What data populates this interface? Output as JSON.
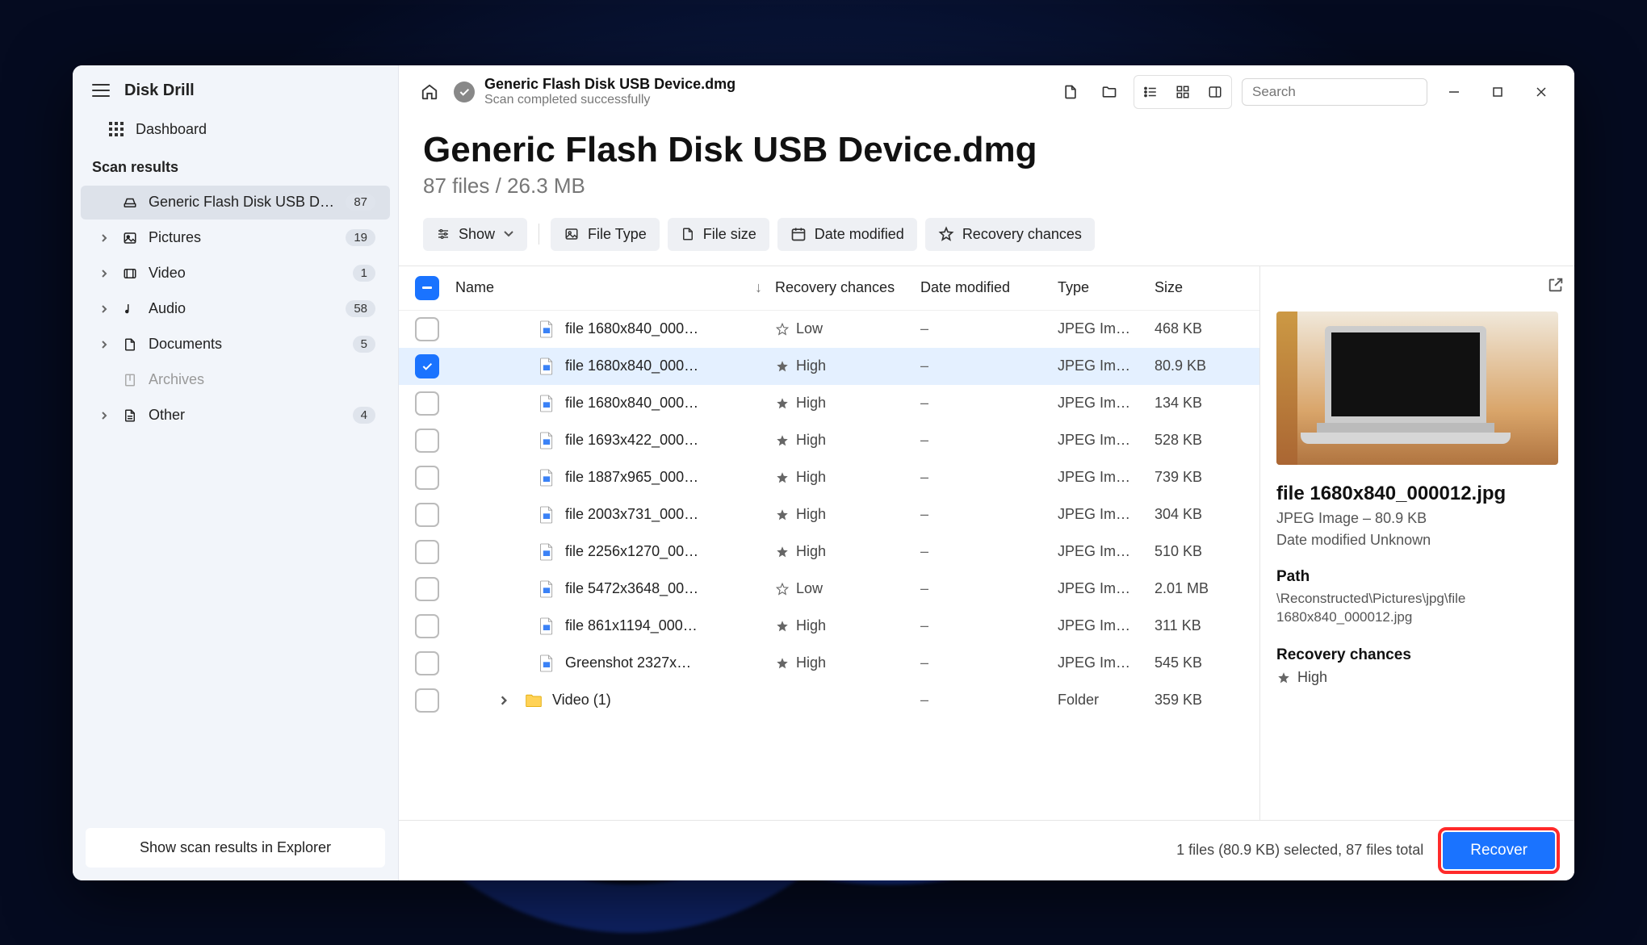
{
  "app_name": "Disk Drill",
  "sidebar": {
    "dashboard": "Dashboard",
    "section": "Scan results",
    "items": [
      {
        "icon": "disk",
        "label": "Generic Flash Disk USB D…",
        "count": "87",
        "active": true,
        "expandable": false
      },
      {
        "icon": "picture",
        "label": "Pictures",
        "count": "19",
        "active": false,
        "expandable": true
      },
      {
        "icon": "video",
        "label": "Video",
        "count": "1",
        "active": false,
        "expandable": true
      },
      {
        "icon": "audio",
        "label": "Audio",
        "count": "58",
        "active": false,
        "expandable": true
      },
      {
        "icon": "document",
        "label": "Documents",
        "count": "5",
        "active": false,
        "expandable": true
      },
      {
        "icon": "archive",
        "label": "Archives",
        "count": "",
        "active": false,
        "expandable": false,
        "muted": true
      },
      {
        "icon": "other",
        "label": "Other",
        "count": "4",
        "active": false,
        "expandable": true
      }
    ],
    "footer_button": "Show scan results in Explorer"
  },
  "header": {
    "title": "Generic Flash Disk USB Device.dmg",
    "subtitle": "Scan completed successfully",
    "search_placeholder": "Search"
  },
  "page": {
    "title": "Generic Flash Disk USB Device.dmg",
    "subtitle": "87 files / 26.3 MB"
  },
  "filters": {
    "show": "Show",
    "file_type": "File Type",
    "file_size": "File size",
    "date_modified": "Date modified",
    "recovery": "Recovery chances"
  },
  "columns": {
    "name": "Name",
    "recovery": "Recovery chances",
    "date": "Date modified",
    "type": "Type",
    "size": "Size"
  },
  "rows": [
    {
      "checked": false,
      "name": "file 1680x840_000…",
      "chance": "Low",
      "star": "hollow",
      "date": "–",
      "type": "JPEG Im…",
      "size": "468 KB",
      "kind": "file"
    },
    {
      "checked": true,
      "name": "file 1680x840_000…",
      "chance": "High",
      "star": "filled",
      "date": "–",
      "type": "JPEG Im…",
      "size": "80.9 KB",
      "kind": "file"
    },
    {
      "checked": false,
      "name": "file 1680x840_000…",
      "chance": "High",
      "star": "filled",
      "date": "–",
      "type": "JPEG Im…",
      "size": "134 KB",
      "kind": "file"
    },
    {
      "checked": false,
      "name": "file 1693x422_000…",
      "chance": "High",
      "star": "filled",
      "date": "–",
      "type": "JPEG Im…",
      "size": "528 KB",
      "kind": "file"
    },
    {
      "checked": false,
      "name": "file 1887x965_000…",
      "chance": "High",
      "star": "filled",
      "date": "–",
      "type": "JPEG Im…",
      "size": "739 KB",
      "kind": "file"
    },
    {
      "checked": false,
      "name": "file 2003x731_000…",
      "chance": "High",
      "star": "filled",
      "date": "–",
      "type": "JPEG Im…",
      "size": "304 KB",
      "kind": "file"
    },
    {
      "checked": false,
      "name": "file 2256x1270_00…",
      "chance": "High",
      "star": "filled",
      "date": "–",
      "type": "JPEG Im…",
      "size": "510 KB",
      "kind": "file"
    },
    {
      "checked": false,
      "name": "file 5472x3648_00…",
      "chance": "Low",
      "star": "hollow",
      "date": "–",
      "type": "JPEG Im…",
      "size": "2.01 MB",
      "kind": "file"
    },
    {
      "checked": false,
      "name": "file 861x1194_000…",
      "chance": "High",
      "star": "filled",
      "date": "–",
      "type": "JPEG Im…",
      "size": "311 KB",
      "kind": "file"
    },
    {
      "checked": false,
      "name": "Greenshot 2327x…",
      "chance": "High",
      "star": "filled",
      "date": "–",
      "type": "JPEG Im…",
      "size": "545 KB",
      "kind": "file"
    },
    {
      "checked": false,
      "name": "Video (1)",
      "chance": "",
      "star": "",
      "date": "–",
      "type": "Folder",
      "size": "359 KB",
      "kind": "folder"
    }
  ],
  "preview": {
    "filename": "file 1680x840_000012.jpg",
    "meta": "JPEG Image – 80.9 KB",
    "date_modified": "Date modified Unknown",
    "path_label": "Path",
    "path": "\\Reconstructed\\Pictures\\jpg\\file 1680x840_000012.jpg",
    "rc_label": "Recovery chances",
    "rc_value": "High"
  },
  "footer": {
    "status": "1 files (80.9 KB) selected, 87 files total",
    "recover": "Recover"
  }
}
